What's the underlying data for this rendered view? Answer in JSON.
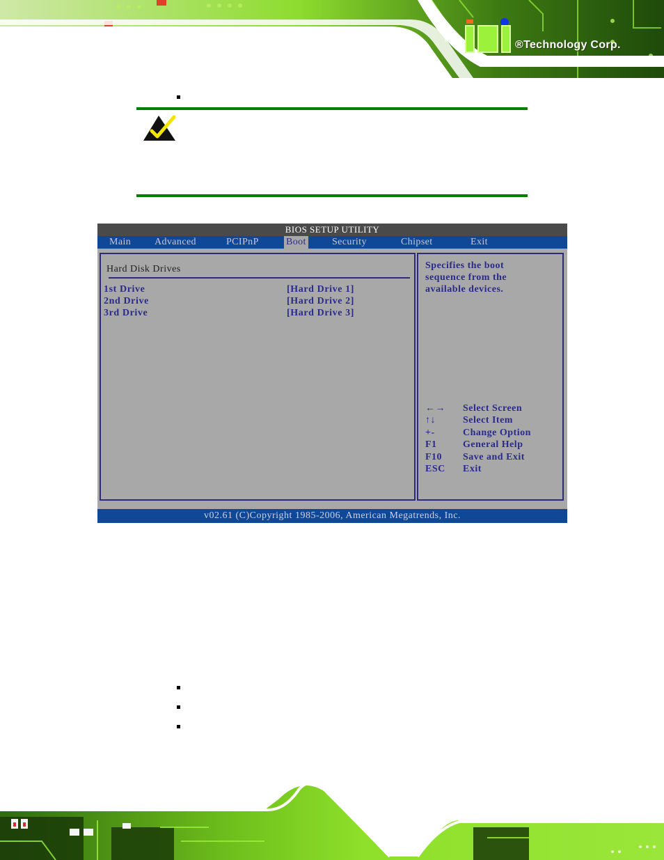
{
  "header": {
    "brand_text": "®Technology Corp.",
    "logo_name": "iEi",
    "colors": {
      "board_green": "#7ed321",
      "dark_green": "#1f4a0a",
      "logo_orange": "#f06a1e",
      "logo_blue": "#1034e6"
    }
  },
  "note": {
    "icon": "checkmark-triangle-icon",
    "rule_color": "#008000"
  },
  "bios": {
    "title": "BIOS SETUP UTILITY",
    "tabs": [
      {
        "label": "Main",
        "active": false
      },
      {
        "label": "Advanced",
        "active": false
      },
      {
        "label": "PCIPnP",
        "active": false
      },
      {
        "label": "Boot",
        "active": true
      },
      {
        "label": "Security",
        "active": false
      },
      {
        "label": "Chipset",
        "active": false
      },
      {
        "label": "Exit",
        "active": false
      }
    ],
    "section_title": "Hard Disk Drives",
    "drives": [
      {
        "label": "1st Drive",
        "value": "[Hard Drive 1]"
      },
      {
        "label": "2nd Drive",
        "value": "[Hard Drive 2]"
      },
      {
        "label": "3rd Drive",
        "value": "[Hard Drive 3]"
      }
    ],
    "help_lines": [
      "Specifies the boot",
      "sequence from the",
      "available devices."
    ],
    "keys": [
      {
        "key": "←→",
        "desc": "Select Screen"
      },
      {
        "key": "↑↓",
        "desc": "Select Item"
      },
      {
        "key": "+-",
        "desc": "Change Option"
      },
      {
        "key": "F1",
        "desc": "General Help"
      },
      {
        "key": "F10",
        "desc": "Save and Exit"
      },
      {
        "key": "ESC",
        "desc": "Exit"
      }
    ],
    "footer": "v02.61 (C)Copyright 1985-2006, American Megatrends, Inc.",
    "colors": {
      "title_bar": "#4a4a4a",
      "menu_bar": "#0f4896",
      "panel_bg": "#a8a8a8",
      "text_blue": "#2a2a8a"
    }
  }
}
